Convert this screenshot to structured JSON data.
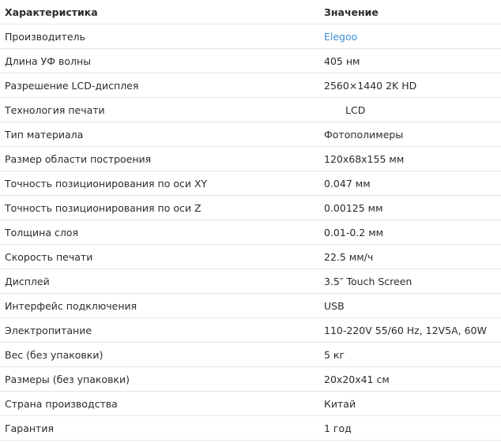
{
  "header": {
    "name": "Характеристика",
    "value": "Значение"
  },
  "rows": [
    {
      "name": "Производитель",
      "value": "Elegoo"
    },
    {
      "name": "Длина УФ волны",
      "value": "405 нм"
    },
    {
      "name": "Разрешение LCD-дисплея",
      "value": "2560×1440 2K HD"
    },
    {
      "name": "Технология печати",
      "value": "LCD"
    },
    {
      "name": "Тип материала",
      "value": "Фотополимеры"
    },
    {
      "name": "Размер области построения",
      "value": "120х68х155 мм"
    },
    {
      "name": "Точность позиционирования по оси XY",
      "value": "0.047 мм"
    },
    {
      "name": "Точность позиционирования по оси Z",
      "value": "0.00125 мм"
    },
    {
      "name": "Толщина слоя",
      "value": "0.01-0.2 мм"
    },
    {
      "name": "Скорость печати",
      "value": "22.5 мм/ч"
    },
    {
      "name": "Дисплей",
      "value": "3.5″ Touch Screen"
    },
    {
      "name": "Интерфейс подключения",
      "value": "USB"
    },
    {
      "name": "Электропитание",
      "value": "110-220V 55/60 Hz, 12V5A, 60W"
    },
    {
      "name": "Вес (без упаковки)",
      "value": "5 кг"
    },
    {
      "name": "Размеры (без упаковки)",
      "value": "20х20х41 см"
    },
    {
      "name": "Страна производства",
      "value": "Китай"
    },
    {
      "name": "Гарантия",
      "value": "1 год"
    }
  ],
  "colors": {
    "link": "#3a8fd6",
    "text": "#2b2b2b",
    "divider": "#e6e6e6"
  }
}
